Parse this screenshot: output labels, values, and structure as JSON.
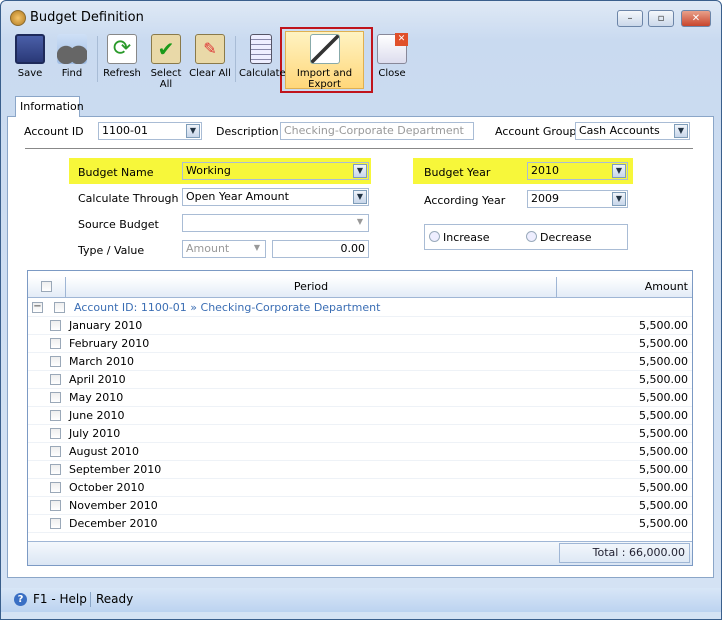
{
  "window": {
    "title": "Budget Definition"
  },
  "toolbar": {
    "items": [
      {
        "label": "Save",
        "icon": "save-icon"
      },
      {
        "label": "Find",
        "icon": "binoculars-icon"
      },
      {
        "label": "Refresh",
        "icon": "refresh-icon"
      },
      {
        "label": "Select All",
        "icon": "select-all-icon"
      },
      {
        "label": "Clear All",
        "icon": "clear-all-icon"
      },
      {
        "label": "Calculate",
        "icon": "calculator-icon"
      },
      {
        "label": "Import and Export",
        "icon": "import-export-icon"
      },
      {
        "label": "Close",
        "icon": "close-window-icon"
      }
    ],
    "highlight_color": "#c0141c"
  },
  "tabs": [
    {
      "label": "Information"
    }
  ],
  "header": {
    "account_id_label": "Account ID",
    "account_id": "1100-01",
    "description_label": "Description",
    "description": "Checking-Corporate Department",
    "account_group_label": "Account Group",
    "account_group": "Cash Accounts"
  },
  "form": {
    "budget_name_label": "Budget Name",
    "budget_name": "Working",
    "calculate_through_label": "Calculate Through",
    "calculate_through": "Open Year Amount",
    "source_budget_label": "Source Budget",
    "source_budget": "",
    "type_value_label": "Type / Value",
    "type": "Amount",
    "value": "0.00",
    "budget_year_label": "Budget Year",
    "budget_year": "2010",
    "according_year_label": "According Year",
    "according_year": "2009",
    "increase_label": "Increase",
    "decrease_label": "Decrease",
    "highlight_color": "#f7f73a"
  },
  "grid": {
    "columns": [
      "Period",
      "Amount"
    ],
    "group": "Account ID: 1100-01 » Checking-Corporate Department",
    "rows": [
      {
        "period": "January 2010",
        "amount": "5,500.00"
      },
      {
        "period": "February 2010",
        "amount": "5,500.00"
      },
      {
        "period": "March 2010",
        "amount": "5,500.00"
      },
      {
        "period": "April 2010",
        "amount": "5,500.00"
      },
      {
        "period": "May 2010",
        "amount": "5,500.00"
      },
      {
        "period": "June 2010",
        "amount": "5,500.00"
      },
      {
        "period": "July 2010",
        "amount": "5,500.00"
      },
      {
        "period": "August 2010",
        "amount": "5,500.00"
      },
      {
        "period": "September 2010",
        "amount": "5,500.00"
      },
      {
        "period": "October 2010",
        "amount": "5,500.00"
      },
      {
        "period": "November 2010",
        "amount": "5,500.00"
      },
      {
        "period": "December 2010",
        "amount": "5,500.00"
      }
    ],
    "total": "Total : 66,000.00"
  },
  "status": {
    "help": "F1 - Help",
    "state": "Ready"
  }
}
